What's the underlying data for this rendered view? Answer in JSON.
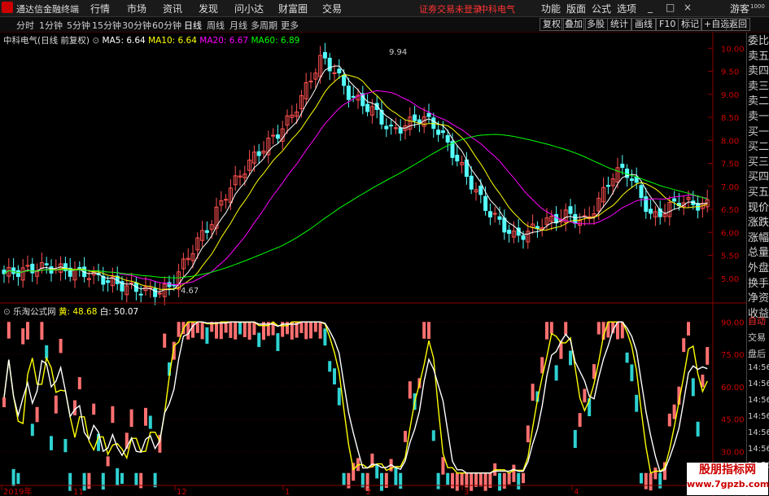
{
  "titlebar": {
    "app_title": "通达信金融终端",
    "login_warning": "证劵交易未登录",
    "stock_name": "中科电气",
    "guest": "游客"
  },
  "main_menu": [
    "行情",
    "市场",
    "资讯",
    "发现",
    "问小达",
    "财富圈",
    "交易"
  ],
  "right_menu": [
    "功能",
    "版面",
    "公式",
    "选项"
  ],
  "window_buttons": [
    "_",
    "□",
    "×"
  ],
  "toolbar": {
    "periods": [
      "分时",
      "1分钟",
      "5分钟",
      "15分钟",
      "30分钟",
      "60分钟",
      "日线",
      "周线",
      "月线",
      "多周期",
      "更多"
    ],
    "active_period": "日线",
    "right_buttons": [
      "复权",
      "叠加",
      "多股",
      "统计",
      "画线",
      "F10",
      "标记",
      "+自选",
      "返回"
    ]
  },
  "price_legend": {
    "title": "中科电气(日线 前复权)",
    "ma": [
      {
        "label": "MA5: 6.64",
        "color": "#ffffff"
      },
      {
        "label": "MA10: 6.64",
        "color": "#ffff00"
      },
      {
        "label": "MA20: 6.67",
        "color": "#ff00ff"
      },
      {
        "label": "MA60: 6.89",
        "color": "#00ff00"
      }
    ],
    "high_label": "9.94",
    "low_label": "4.67"
  },
  "indicator_legend": {
    "name": "乐淘公式网",
    "items": [
      {
        "label": "黄: 48.68",
        "color": "#ffff00"
      },
      {
        "label": "白: 50.07",
        "color": "#ffffff"
      }
    ]
  },
  "right_panel": {
    "items": [
      "委比",
      "卖五",
      "卖四",
      "卖三",
      "卖二",
      "卖一",
      "买一",
      "买二",
      "买三",
      "买四",
      "买五",
      "现价",
      "涨跌",
      "涨幅",
      "总量",
      "外盘",
      "换手",
      "净资",
      "收益"
    ],
    "lower_items": [
      "自动",
      "交易",
      "盘后",
      "14:56",
      "14:56",
      "14:56",
      "14:56",
      "14:56",
      "14:56",
      "14:56"
    ],
    "counter": "1000"
  },
  "x_axis": [
    "2019年",
    "11",
    "12",
    "1",
    "2",
    "3",
    "4"
  ],
  "watermark": {
    "line1": "股朋指标网",
    "line2": "www.7gpzb.com"
  },
  "chart_data": [
    {
      "type": "candlestick",
      "title": "中科电气(日线 前复权)",
      "ylim": [
        4.5,
        10.2
      ],
      "y_ticks": [
        5.0,
        5.5,
        6.0,
        6.5,
        7.0,
        7.5,
        8.0,
        8.5,
        9.0,
        9.5,
        10.0
      ],
      "candles_sampled": [
        5.1,
        5.15,
        5.2,
        5.25,
        5.2,
        5.15,
        5.1,
        5.0,
        4.9,
        4.8,
        4.75,
        4.7,
        4.8,
        5.3,
        5.8,
        6.2,
        6.8,
        7.2,
        7.6,
        7.9,
        8.2,
        8.6,
        9.2,
        9.8,
        9.5,
        9.0,
        8.8,
        8.6,
        8.2,
        8.3,
        8.5,
        8.4,
        8.0,
        7.5,
        7.0,
        6.5,
        6.2,
        5.9,
        6.0,
        6.2,
        6.3,
        6.4,
        6.2,
        6.6,
        7.2,
        7.4,
        6.9,
        6.3,
        6.5,
        6.7,
        6.6,
        6.6
      ],
      "ma_series": [
        {
          "name": "MA5",
          "color": "#ffffff"
        },
        {
          "name": "MA10",
          "color": "#ffff00"
        },
        {
          "name": "MA20",
          "color": "#ff00ff"
        },
        {
          "name": "MA60",
          "color": "#00ff00"
        }
      ]
    },
    {
      "type": "bar",
      "title": "乐淘公式网",
      "ylim": [
        15,
        95
      ],
      "y_ticks": [
        30.0,
        45.0,
        60.0,
        75.0,
        90.0
      ],
      "series": [
        {
          "name": "黄",
          "color": "#ffff00"
        },
        {
          "name": "白",
          "color": "#ffffff"
        }
      ]
    }
  ]
}
